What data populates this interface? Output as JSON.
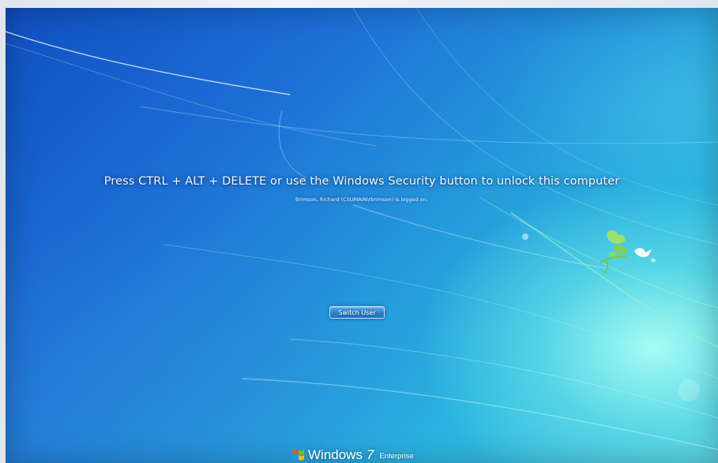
{
  "lock_screen": {
    "instruction": "Press CTRL + ALT + DELETE or use the Windows Security button to unlock this computer",
    "logged_on_user": "Brimson, Richard (CSUMAIN\\rbrimson) is logged on.",
    "switch_user_label": "Switch User"
  },
  "branding": {
    "product_name": "Windows",
    "version": "7",
    "edition": "Enterprise",
    "logo_icon": "windows-flag-icon"
  },
  "decor": {
    "bird_icon": "bird-icon",
    "colors": {
      "background_deep": "#0f4fc1",
      "background_mid": "#2497db",
      "background_light": "#5fd7e6",
      "text": "#f4f8ff"
    }
  }
}
